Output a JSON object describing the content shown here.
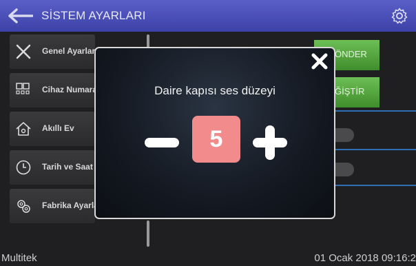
{
  "header": {
    "title": "SİSTEM AYARLARI"
  },
  "sidebar": {
    "items": [
      {
        "label": "Genel Ayarlar",
        "icon": "tools-icon"
      },
      {
        "label": "Cihaz Numara",
        "icon": "device-number-icon"
      },
      {
        "label": "Akıllı Ev",
        "icon": "smart-home-icon"
      },
      {
        "label": "Tarih ve Saat",
        "icon": "clock-icon"
      },
      {
        "label": "Fabrika Ayarla",
        "icon": "factory-settings-icon"
      }
    ]
  },
  "background": {
    "send_button_partial": "ÖNDER",
    "change_button_partial": "ĞİŞTİR"
  },
  "footer": {
    "brand": "Multitek",
    "datetime": "01 Ocak 2018 09:16:2"
  },
  "dialog": {
    "title": "Daire kapısı ses düzeyi",
    "value": "5"
  },
  "colors": {
    "header": "#4a4fb8",
    "value_box": "#f28c8c",
    "green_button": "#57a843",
    "accent_line": "#2f6fb3"
  }
}
